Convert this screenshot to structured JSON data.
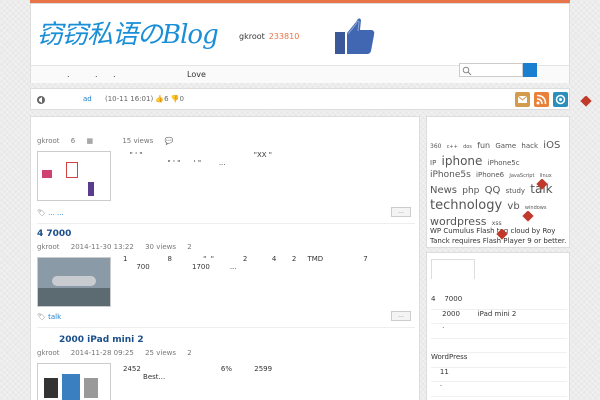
{
  "header": {
    "logo": "窃窃私语のBlog",
    "user": "gkroot",
    "count": "233810"
  },
  "nav": {
    "items": [
      ".",
      ".",
      ".",
      "Love"
    ],
    "search_placeholder": ""
  },
  "notice": {
    "link": "ad",
    "meta": "(10-11 16:01) 👍6 👎0"
  },
  "posts": [
    {
      "title": "",
      "author": "gkroot",
      "cat": "6",
      "views": "15 views",
      "comments": "",
      "excerpt": "   \" ' \"                                                  \"XX \"\n                    \" ' \"      ' \"        ...",
      "tags": "... ...",
      "more": "..."
    },
    {
      "title": "4    7000",
      "author": "gkroot",
      "date": "2014-11-30 13:22",
      "views": "30 views",
      "comments": "2",
      "excerpt": "1                  8              \"  \"             2           4       2     TMD                  7\n      700                   1700         ...",
      "tags": "talk",
      "more": "..."
    },
    {
      "title": "2000        iPad mini 2",
      "author": "gkroot",
      "date": "2014-11-28 09:25",
      "views": "25 views",
      "comments": "2",
      "excerpt": "2452                                    6%          2599\n         Best..."
    }
  ],
  "tagcloud": {
    "tags": [
      {
        "t": "360",
        "s": 6
      },
      {
        "t": "c++",
        "s": 5
      },
      {
        "t": "dos",
        "s": 5
      },
      {
        "t": "fun",
        "s": 8
      },
      {
        "t": "Game",
        "s": 7
      },
      {
        "t": "hack",
        "s": 7
      },
      {
        "t": "iOS",
        "s": 10
      },
      {
        "t": "IP",
        "s": 7
      },
      {
        "t": "iphone",
        "s": 12
      },
      {
        "t": "iPhone5c",
        "s": 7
      },
      {
        "t": "iPhone5s",
        "s": 9
      },
      {
        "t": "iPhone6",
        "s": 7
      },
      {
        "t": "JavaScript",
        "s": 5
      },
      {
        "t": "linux",
        "s": 5
      },
      {
        "t": "News",
        "s": 10
      },
      {
        "t": "php",
        "s": 9
      },
      {
        "t": "QQ",
        "s": 10
      },
      {
        "t": "study",
        "s": 7
      },
      {
        "t": "talk",
        "s": 12
      },
      {
        "t": "technology",
        "s": 13
      },
      {
        "t": "vb",
        "s": 10
      },
      {
        "t": "windows",
        "s": 5
      },
      {
        "t": "wordpress",
        "s": 11
      },
      {
        "t": "xss",
        "s": 6
      }
    ],
    "note": "WP Cumulus Flash tag cloud by Roy Tanck requires Flash Player 9 or better."
  },
  "sidebar": {
    "list": [
      "4    7000",
      "     2000        iPad mini 2",
      "     ·",
      "",
      "WordPress",
      "    11",
      "    ·"
    ]
  },
  "colors": {
    "accent": "#e8754a",
    "link": "#1a7fd0",
    "title": "#1a4f8b"
  }
}
